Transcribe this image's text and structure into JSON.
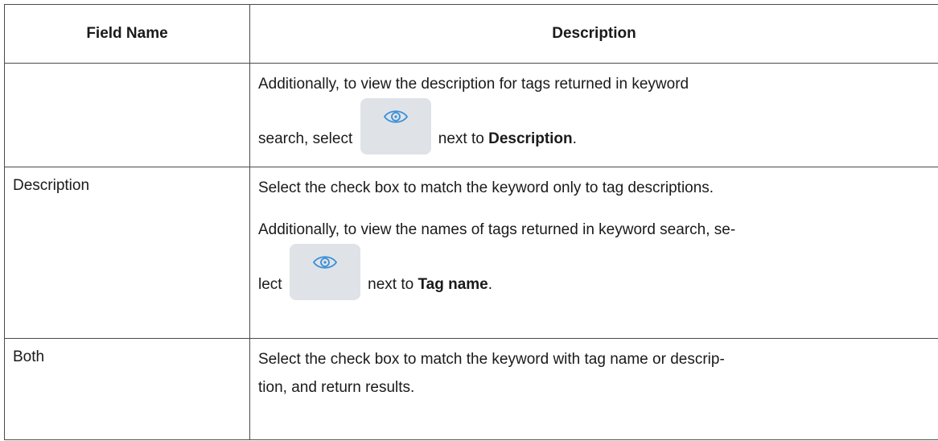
{
  "table": {
    "headers": [
      "Field Name",
      "Description"
    ],
    "rows": [
      {
        "name": "",
        "desc1": "Additionally, to view the description for tags returned in keyword",
        "desc2_before": "search, select",
        "desc2_after": "next to",
        "desc2_bold": "Description",
        "desc2_end": ".",
        "icon": "eye-icon"
      },
      {
        "name": "Description",
        "desc1": "Select the check box to match the keyword only to tag descriptions.",
        "desc2": "Additionally, to view the names of tags returned in keyword search, se-",
        "desc3_before": "lect",
        "desc3_after": "next to",
        "desc3_bold": "Tag name",
        "desc3_end": ".",
        "icon": "eye-icon"
      },
      {
        "name": "Both",
        "desc1": "Select the check box to match the keyword with tag name or descrip-",
        "desc2": "tion, and return results."
      }
    ]
  },
  "colors": {
    "icon_bg": "#dfe3e8",
    "icon_stroke": "#3a8fd6",
    "border": "#4a4a4a"
  }
}
